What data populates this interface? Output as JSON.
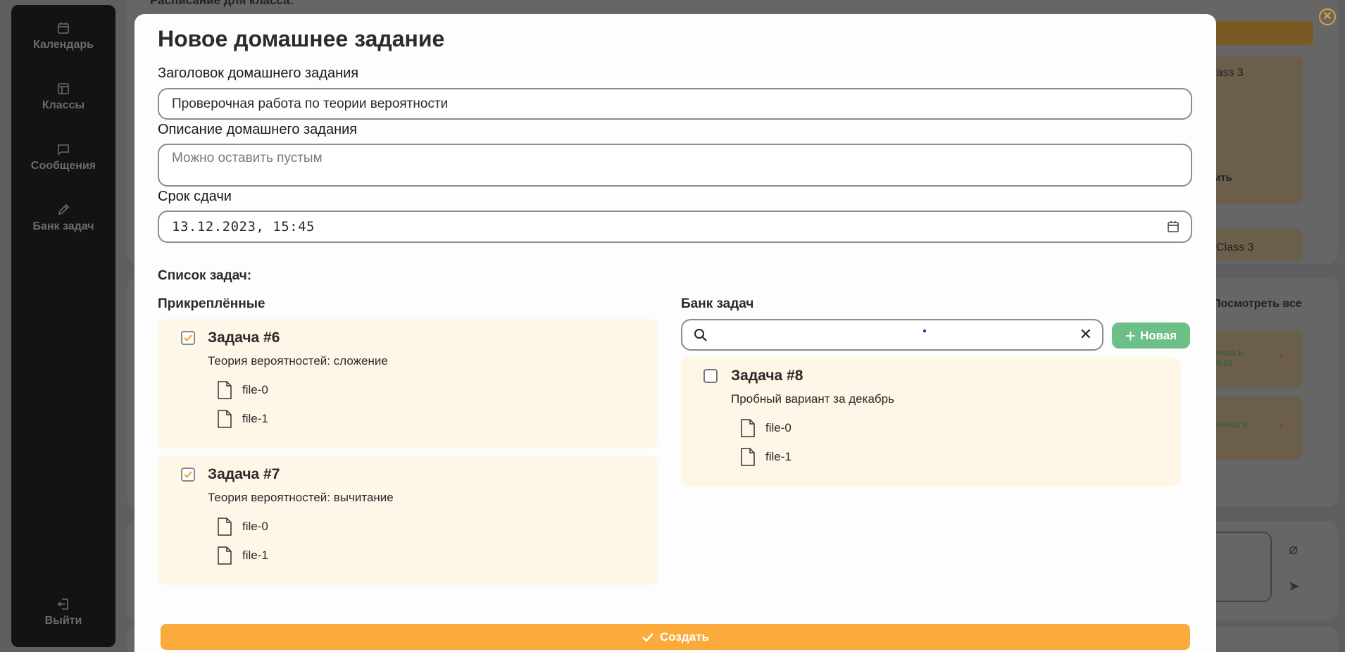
{
  "sidebar": {
    "items": [
      {
        "label": "Календарь",
        "icon": "calendar-icon"
      },
      {
        "label": "Классы",
        "icon": "layout-icon"
      },
      {
        "label": "Сообщения",
        "icon": "message-icon"
      },
      {
        "label": "Банк задач",
        "icon": "pencil-icon"
      }
    ],
    "logout_label": "Выйти"
  },
  "background": {
    "header_text": "Расписание для класса:",
    "class_label_1": "lass 3",
    "fragment_1": "ить",
    "class_label_2": "Class 3",
    "view_all": "Посмотреть все",
    "fragment_2a": "чера в",
    "fragment_2b": "9:22",
    "fragment_3a": "назад в"
  },
  "modal": {
    "title": "Новое домашнее задание",
    "title_field_label": "Заголовок домашнего задания",
    "title_field_value": "Проверочная работа по теории вероятности",
    "desc_field_label": "Описание домашнего задания",
    "desc_field_placeholder": "Можно оставить пустым",
    "due_label": "Срок сдачи",
    "due_value": "13.12.2023, 15:45",
    "task_list_label": "Список задач:",
    "attached_label": "Прикреплённые",
    "bank_label": "Банк задач",
    "new_button_label": "Новая",
    "create_button_label": "Создать",
    "attached_tasks": [
      {
        "title": "Задача #6",
        "desc": "Теория вероятностей: сложение",
        "checked": true,
        "files": [
          "file-0",
          "file-1"
        ]
      },
      {
        "title": "Задача #7",
        "desc": "Теория вероятностей: вычитание",
        "checked": true,
        "files": [
          "file-0",
          "file-1"
        ]
      }
    ],
    "bank_tasks": [
      {
        "title": "Задача #8",
        "desc": "Пробный вариант за декабрь",
        "checked": false,
        "files": [
          "file-0",
          "file-1"
        ]
      }
    ]
  },
  "colors": {
    "accent": "#fbaa3c",
    "new_button": "#6bbf87",
    "card_bg": "#fef6e7"
  }
}
